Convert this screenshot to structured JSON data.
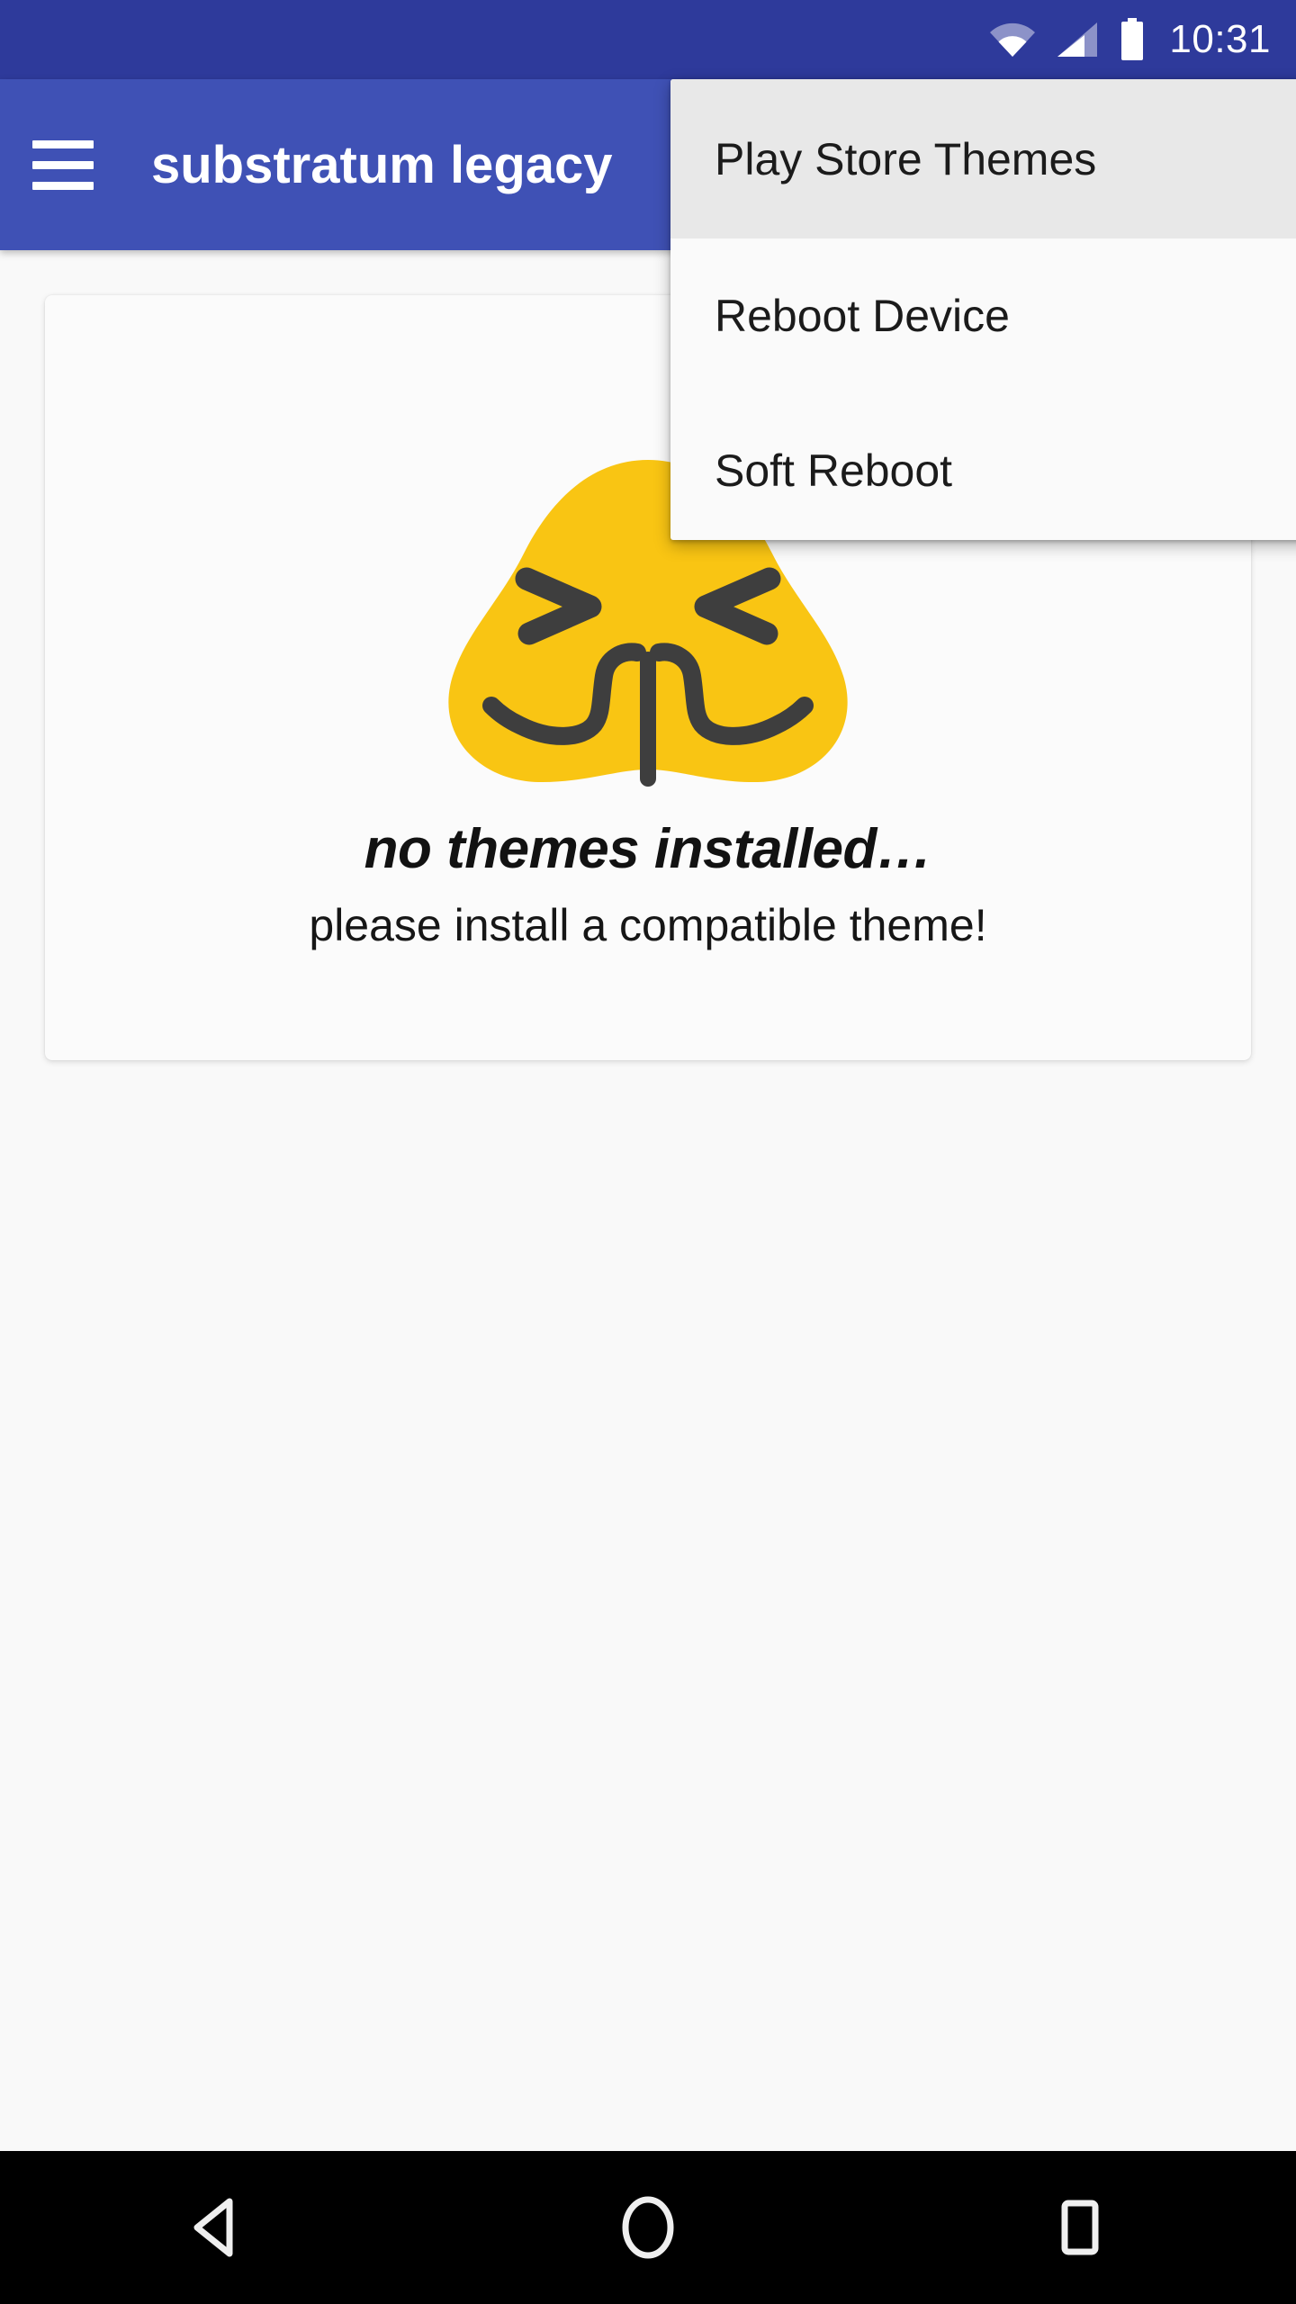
{
  "status_bar": {
    "time": "10:31",
    "icons": [
      "wifi-icon",
      "cellular-signal-icon",
      "battery-icon"
    ],
    "background_color": "#2E3A9B"
  },
  "app_bar": {
    "title": "substratum legacy",
    "menu_icon": "hamburger-menu-icon",
    "background_color": "#3F51B5",
    "text_color": "#FFFFFF"
  },
  "overflow_menu": {
    "visible": true,
    "background_color": "#FAFAFA",
    "highlight_color": "#E8E8E8",
    "items": [
      {
        "label": "Play Store Themes",
        "highlighted": true
      },
      {
        "label": "Reboot Device",
        "highlighted": false
      },
      {
        "label": "Soft Reboot",
        "highlighted": false
      }
    ]
  },
  "content": {
    "card": {
      "emoji": "folded-hands-emoji",
      "emoji_colors": {
        "fill": "#F9C513",
        "features": "#3E3E3E"
      },
      "title": "no themes installed…",
      "subtitle": "please install a compatible theme!",
      "background_color": "#FBFBFB"
    },
    "background_color": "#F9F9F9"
  },
  "nav_bar": {
    "background_color": "#000000",
    "buttons": [
      {
        "name": "back-button",
        "icon": "back-triangle-icon"
      },
      {
        "name": "home-button",
        "icon": "home-circle-icon"
      },
      {
        "name": "recents-button",
        "icon": "recents-square-icon"
      }
    ]
  }
}
